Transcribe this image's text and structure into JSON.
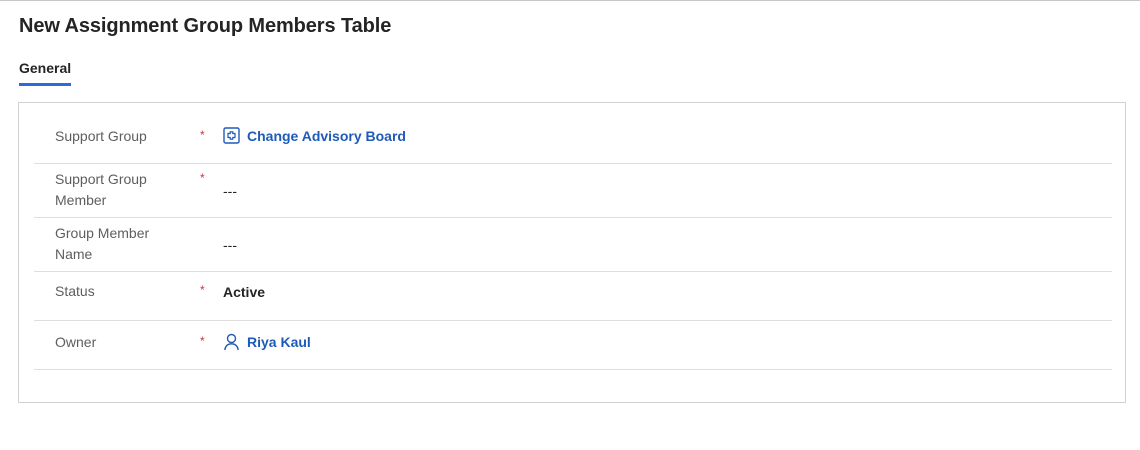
{
  "page": {
    "title": "New Assignment Group Members Table"
  },
  "tabs": [
    {
      "label": "General"
    }
  ],
  "form": {
    "fields": [
      {
        "label": "Support Group",
        "required": "*",
        "value": "Change Advisory Board",
        "icon": "group-record-icon"
      },
      {
        "label": "Support Group Member",
        "required": "*",
        "value": "---"
      },
      {
        "label": "Group Member Name",
        "required": "",
        "value": "---"
      },
      {
        "label": "Status",
        "required": "*",
        "value": "Active"
      },
      {
        "label": "Owner",
        "required": "*",
        "value": "Riya Kaul",
        "icon": "person-icon"
      }
    ]
  },
  "colors": {
    "accent": "#2c6cd6",
    "link": "#1e5bb8",
    "required": "#d13438"
  }
}
